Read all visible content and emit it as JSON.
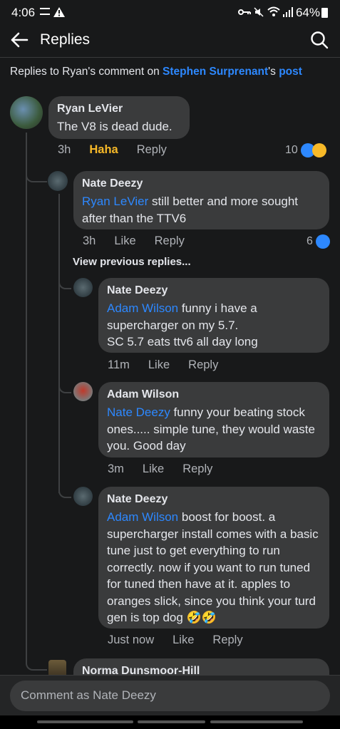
{
  "status_bar": {
    "time": "4:06",
    "battery": "64%"
  },
  "header": {
    "title": "Replies"
  },
  "context": {
    "prefix": "Replies to Ryan's comment on ",
    "author": "Stephen Surprenant",
    "possessive": "'s ",
    "link": "post"
  },
  "comments": [
    {
      "name": "Ryan LeVier",
      "text": "The V8 is dead dude.",
      "time": "3h",
      "reaction_label": "Haha",
      "reply": "Reply",
      "reaction_count": "10"
    },
    {
      "name": "Nate Deezy",
      "mention": "Ryan LeVier",
      "text": " still better and more sought after than the TTV6",
      "time": "3h",
      "like": "Like",
      "reply": "Reply",
      "reaction_count": "6"
    },
    {
      "name": "Nate Deezy",
      "mention": "Adam Wilson",
      "text": " funny i have a supercharger on my 5.7.\nSC 5.7 eats ttv6 all day long",
      "time": "11m",
      "like": "Like",
      "reply": "Reply"
    },
    {
      "name": "Adam Wilson",
      "mention": "Nate Deezy",
      "text": " funny your beating stock ones..... simple tune, they would waste you. Good day",
      "time": "3m",
      "like": "Like",
      "reply": "Reply"
    },
    {
      "name": "Nate Deezy",
      "mention": "Adam Wilson",
      "text": " boost for boost. a supercharger install comes with a basic tune just to get everything to run correctly. now if you want to run tuned for tuned then have at it. apples to oranges slick, since you think your turd gen is top dog 🤣🤣",
      "time": "Just now",
      "like": "Like",
      "reply": "Reply"
    },
    {
      "name": "Norma Dunsmoor-Hill"
    }
  ],
  "view_previous": "View previous replies...",
  "composer": {
    "placeholder": "Comment as Nate Deezy"
  },
  "colors": {
    "background": "#18191a",
    "bubble": "#3a3b3c",
    "link": "#2d88ff",
    "haha": "#f7b928"
  },
  "icons": [
    "back-arrow-icon",
    "search-icon",
    "like-icon",
    "haha-icon"
  ]
}
